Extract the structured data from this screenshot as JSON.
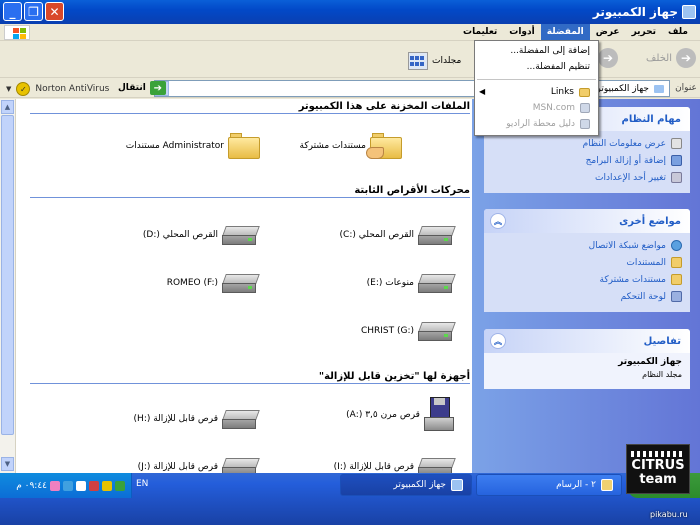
{
  "window": {
    "title": "جهاز الكمبيوتر"
  },
  "menu": [
    {
      "label": "ملف"
    },
    {
      "label": "تحرير"
    },
    {
      "label": "عرض"
    },
    {
      "label": "المفضلة"
    },
    {
      "label": "أدوات"
    },
    {
      "label": "تعليمات"
    }
  ],
  "favorites_menu": {
    "add": "إضافة إلى المفضلة...",
    "organize": "تنظيم المفضلة...",
    "links": "Links",
    "msn": "MSN.com",
    "radio": "دليل محطة الراديو"
  },
  "toolbar": {
    "back": "الخلف",
    "folders": "مجلدات"
  },
  "address": {
    "label": "عنوان",
    "value": "جهاز الكمبيوتر",
    "go": "انتقال",
    "antivirus": "Norton AntiVirus"
  },
  "sections": {
    "stored": "الملفات المخزنة على هذا الكمبيوتر",
    "hard": "محركات الأقراص الثابتة",
    "removable": "أجهزة لها \"تخزين قابل للإزالة\""
  },
  "stored_items": [
    {
      "label": "مستندات مشتركة"
    },
    {
      "label": "Administrator مستندات"
    }
  ],
  "hard_drives": [
    {
      "label": "القرص المحلي (:C)"
    },
    {
      "label": "القرص المحلي (:D)"
    },
    {
      "label": "منوعات (:E)"
    },
    {
      "label": "ROMEO (F:)"
    },
    {
      "label": "CHRIST (G:)"
    }
  ],
  "removable": [
    {
      "label": "قرص مرن ٣,٥ (:A)"
    },
    {
      "label": "قرص قابل للإزالة (:H)"
    },
    {
      "label": "قرص قابل للإزالة (:I)"
    },
    {
      "label": "قرص قابل للإزالة (:J)"
    }
  ],
  "tasks": {
    "system": {
      "title": "مهام النظام",
      "items": [
        {
          "label": "عرض معلومات النظام"
        },
        {
          "label": "إضافة أو إزالة البرامج"
        },
        {
          "label": "تغيير أحد الإعدادات"
        }
      ]
    },
    "other": {
      "title": "مواضع أخرى",
      "items": [
        {
          "label": "مواضع شبكة الاتصال"
        },
        {
          "label": "المستندات"
        },
        {
          "label": "مستندات مشتركة"
        },
        {
          "label": "لوحة التحكم"
        }
      ]
    },
    "details": {
      "title": "تفاصيل",
      "name": "جهاز الكمبيوتر",
      "sub": "مجلد النظام"
    }
  },
  "taskbar": {
    "paint": "٢ - الرسام",
    "computer": "جهاز الكمبيوتر",
    "lang": "EN",
    "clock": "٠٩:٤٤ م"
  },
  "watermark": {
    "line1": "CITRUS",
    "line2": "team",
    "site": "pikabu.ru"
  }
}
